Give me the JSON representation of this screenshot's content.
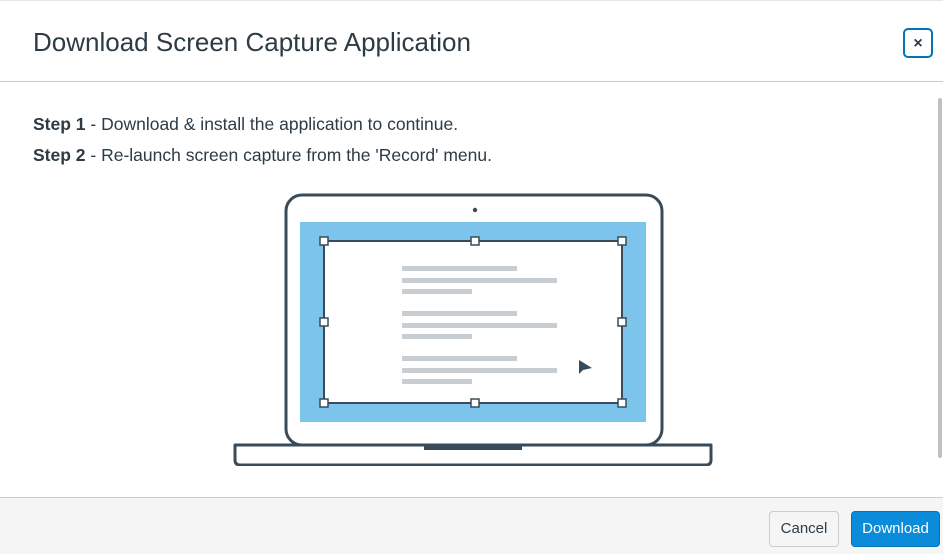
{
  "dialog": {
    "title": "Download Screen Capture Application",
    "close_label": "×"
  },
  "steps": [
    {
      "label": "Step 1",
      "text": " - Download & install the application to continue."
    },
    {
      "label": "Step 2",
      "text": " - Re-launch screen capture from the 'Record' menu."
    }
  ],
  "footer": {
    "cancel_label": "Cancel",
    "download_label": "Download"
  },
  "colors": {
    "accent": "#0b8cdb",
    "screen": "#7cc4ec",
    "outline": "#394b58"
  },
  "icons": {
    "close": "close-icon",
    "illustration": "laptop-screen-capture-illustration",
    "cursor": "cursor-arrow-icon"
  }
}
